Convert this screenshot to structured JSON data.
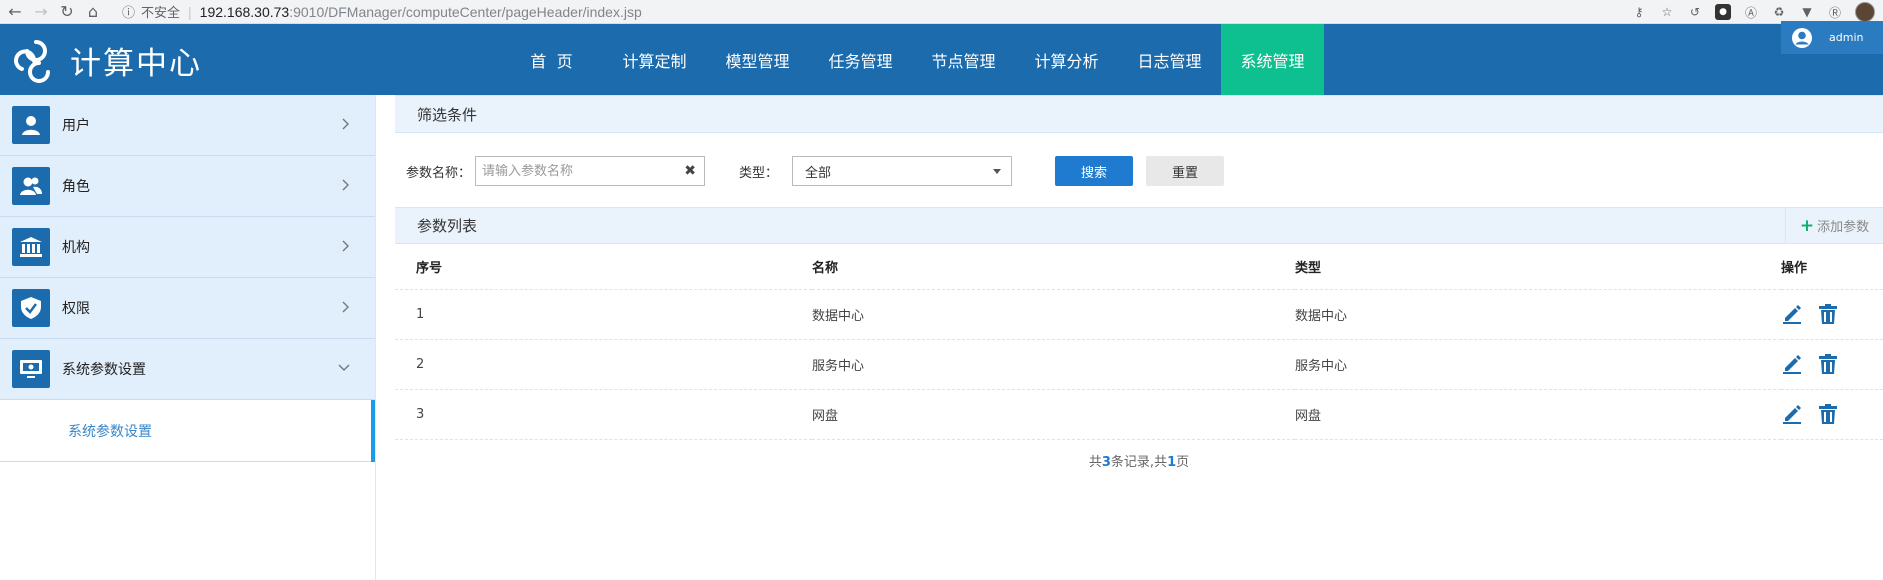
{
  "browser": {
    "insecure_label": "不安全",
    "url_host": "192.168.30.73",
    "url_path": ":9010/DFManager/computeCenter/pageHeader/index.jsp"
  },
  "header": {
    "title": "计算中心",
    "nav": [
      {
        "label": "首  页"
      },
      {
        "label": "计算定制"
      },
      {
        "label": "模型管理"
      },
      {
        "label": "任务管理"
      },
      {
        "label": "节点管理"
      },
      {
        "label": "计算分析"
      },
      {
        "label": "日志管理"
      },
      {
        "label": "系统管理",
        "active": true
      }
    ],
    "user": "admin"
  },
  "sidebar": {
    "items": [
      {
        "label": "用户",
        "icon": "user-icon"
      },
      {
        "label": "角色",
        "icon": "users-icon"
      },
      {
        "label": "机构",
        "icon": "institution-icon"
      },
      {
        "label": "权限",
        "icon": "shield-icon"
      },
      {
        "label": "系统参数设置",
        "icon": "monitor-icon",
        "expanded": true
      }
    ],
    "sub_items": [
      {
        "label": "系统参数设置",
        "active": true
      }
    ]
  },
  "filter": {
    "title": "筛选条件",
    "name_label": "参数名称：",
    "name_placeholder": "请输入参数名称",
    "name_value": "",
    "type_label": "类型：",
    "type_value": "全部",
    "search_label": "搜索",
    "reset_label": "重置"
  },
  "list": {
    "title": "参数列表",
    "add_label": "添加参数",
    "columns": [
      "序号",
      "名称",
      "类型",
      "操作"
    ],
    "rows": [
      {
        "index": "1",
        "name": "数据中心",
        "type": "数据中心"
      },
      {
        "index": "2",
        "name": "服务中心",
        "type": "服务中心"
      },
      {
        "index": "3",
        "name": "网盘",
        "type": "网盘"
      }
    ],
    "pager": {
      "prefix": "共",
      "records": "3",
      "mid": "条记录,共",
      "pages": "1",
      "suffix": "页"
    }
  },
  "colors": {
    "header_bg": "#1b6bad",
    "active_nav": "#0ec08f",
    "sidebar_bg": "#e1eefb",
    "primary_button": "#1e7bd0",
    "add_icon": "#12b06f"
  }
}
